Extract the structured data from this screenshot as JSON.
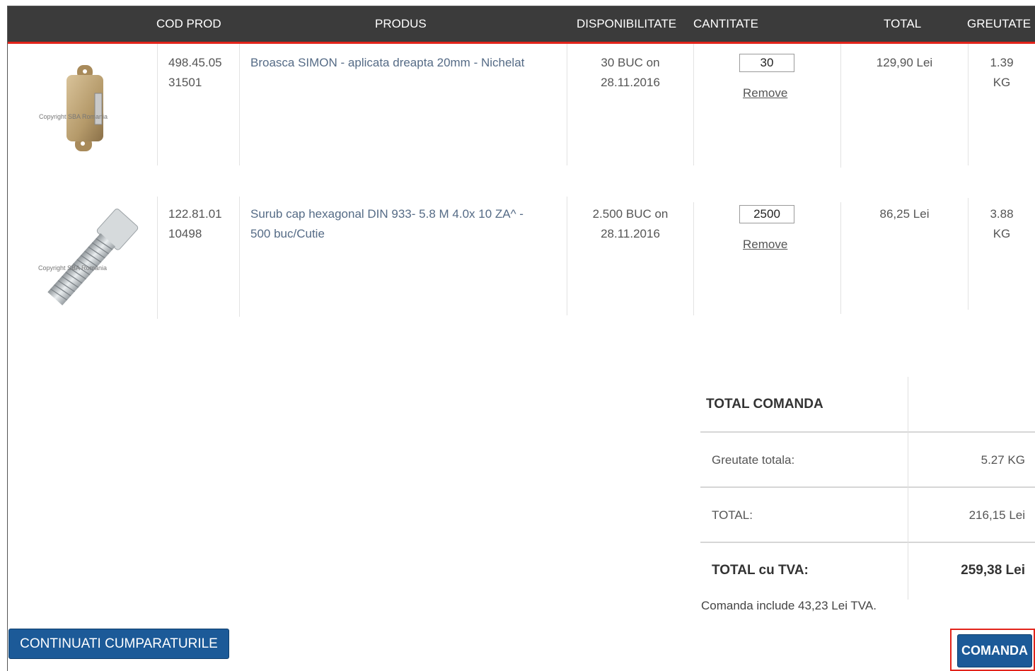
{
  "table": {
    "headers": {
      "cod": "COD PROD",
      "produs": "PRODUS",
      "disponibilitate": "DISPONIBILITATE",
      "cantitate": "CANTITATE",
      "total": "TOTAL",
      "greutate": "GREUTATE"
    },
    "rows": [
      {
        "image_watermark": "Copyright SBA Romania",
        "cod_line1": "498.45.05",
        "cod_line2": "31501",
        "produs": "Broasca SIMON - aplicata dreapta 20mm - Nichelat",
        "disp_line1": "30 BUC on",
        "disp_line2": "28.11.2016",
        "qty": "30",
        "remove": "Remove",
        "total": "129,90 Lei",
        "greutate_line1": "1.39",
        "greutate_line2": "KG"
      },
      {
        "image_watermark": "Copyright SBA Romania",
        "cod_line1": "122.81.01",
        "cod_line2": "10498",
        "produs_line1": "Surub cap hexagonal DIN 933- 5.8 M 4.0x 10 ZA^ -",
        "produs_line2": "500 buc/Cutie",
        "disp_line1": "2.500 BUC on",
        "disp_line2": "28.11.2016",
        "qty": "2500",
        "remove": "Remove",
        "total": "86,25 Lei",
        "greutate_line1": "3.88",
        "greutate_line2": "KG"
      }
    ]
  },
  "summary": {
    "title": "TOTAL COMANDA",
    "weight_label": "Greutate totala:",
    "weight_value": "5.27 KG",
    "total_label": "TOTAL:",
    "total_value": "216,15 Lei",
    "tva_label": "TOTAL cu TVA:",
    "tva_value": "259,38 Lei",
    "vat_note": "Comanda include 43,23 Lei TVA."
  },
  "buttons": {
    "continue": "CONTINUATI CUMPARATURILE",
    "order": "COMANDA"
  },
  "colors": {
    "header_bg": "#3b3b3b",
    "accent_red": "#e2231a",
    "button_blue": "#1c5a98"
  }
}
